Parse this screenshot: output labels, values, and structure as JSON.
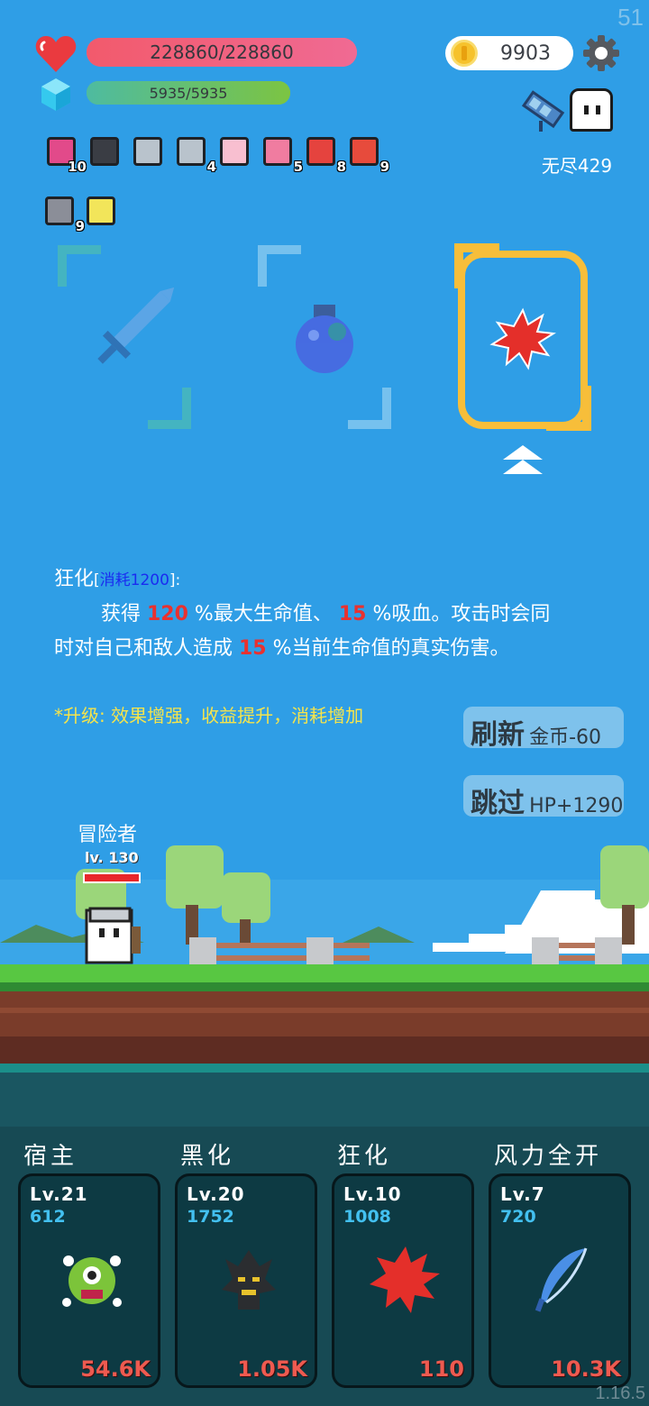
{
  "fps": "51",
  "version": "1.16.5",
  "status": {
    "hp_text": "228860/228860",
    "hp_fraction": 1.0,
    "mp_text": "5935/5935",
    "mp_fraction": 1.0,
    "gold": "9903",
    "endless_label": "无尽429"
  },
  "items": [
    {
      "icon": "jam-jar-icon",
      "count": "10"
    },
    {
      "icon": "skull-book-icon",
      "count": ""
    },
    {
      "icon": "sword-icon",
      "count": ""
    },
    {
      "icon": "sword-icon",
      "count": "4"
    },
    {
      "icon": "heart-card-icon",
      "count": ""
    },
    {
      "icon": "potion-bottle-icon",
      "count": "5"
    },
    {
      "icon": "watermelon-icon",
      "count": "8"
    },
    {
      "icon": "sock-icon",
      "count": "9"
    },
    {
      "icon": "striped-scroll-icon",
      "count": "9"
    },
    {
      "icon": "lightbulb-icon",
      "count": ""
    }
  ],
  "choices": [
    {
      "icon": "blue-sword-icon",
      "selected": false
    },
    {
      "icon": "blue-potion-icon",
      "selected": false
    },
    {
      "icon": "red-splat-icon",
      "selected": true
    }
  ],
  "description": {
    "skill_name": "狂化",
    "cost_label": "消耗1200",
    "line1_prefix": "获得 ",
    "value1": "120",
    "line1_mid": " %最大生命值、 ",
    "value2": "15",
    "line1_suffix": " %吸血。攻击时会同",
    "line2_prefix": "时对自己和敌人造成 ",
    "value3": "15",
    "line2_suffix": " %当前生命值的真实伤害。",
    "upgrade_hint": "*升级: 效果增强，收益提升，消耗增加"
  },
  "buttons": {
    "refresh_label": "刷新",
    "refresh_cost": "金币-60",
    "skip_label": "跳过",
    "skip_reward": "HP+1290"
  },
  "hero": {
    "name": "冒险者",
    "level": "lv. 130",
    "hp_fraction": 1.0
  },
  "skills": [
    {
      "title": "宿主",
      "level": "Lv.21",
      "points": "612",
      "cost": "54.6K",
      "icon": "green-monster-icon"
    },
    {
      "title": "黑化",
      "level": "Lv.20",
      "points": "1752",
      "cost": "1.05K",
      "icon": "dark-tree-icon"
    },
    {
      "title": "狂化",
      "level": "Lv.10",
      "points": "1008",
      "cost": "110",
      "icon": "red-splat-icon"
    },
    {
      "title": "风力全开",
      "level": "Lv.7",
      "points": "720",
      "cost": "10.3K",
      "icon": "feather-icon"
    }
  ],
  "colors": {
    "sky": "#2f9ee6",
    "accent_gold": "#f7be3a",
    "damage_red": "#e9312f",
    "cost_blue": "#1a2cf0",
    "hint_yellow": "#f5e44c"
  }
}
